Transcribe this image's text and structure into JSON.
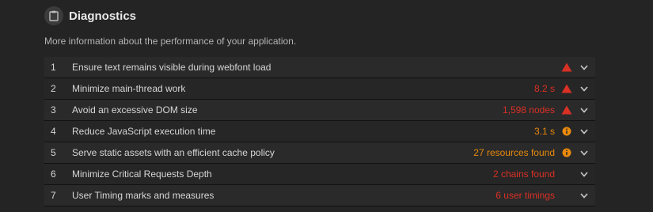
{
  "section": {
    "title": "Diagnostics",
    "description": "More information about the performance of your application.",
    "icon": "clipboard-icon"
  },
  "colors": {
    "fail": "#d93025",
    "average": "#e8890c"
  },
  "audits": [
    {
      "index": "1",
      "label": "Ensure text remains visible during webfont load",
      "value": "",
      "status": "fail",
      "status_icon": "warning-triangle-icon"
    },
    {
      "index": "2",
      "label": "Minimize main-thread work",
      "value": "8.2 s",
      "status": "fail",
      "status_icon": "warning-triangle-icon"
    },
    {
      "index": "3",
      "label": "Avoid an excessive DOM size",
      "value": "1,598 nodes",
      "status": "fail",
      "status_icon": "warning-triangle-icon"
    },
    {
      "index": "4",
      "label": "Reduce JavaScript execution time",
      "value": "3.1 s",
      "status": "average",
      "status_icon": "info-circle-icon"
    },
    {
      "index": "5",
      "label": "Serve static assets with an efficient cache policy",
      "value": "27 resources found",
      "status": "average",
      "status_icon": "info-circle-icon"
    },
    {
      "index": "6",
      "label": "Minimize Critical Requests Depth",
      "value": "2 chains found",
      "status": "fail",
      "status_icon": ""
    },
    {
      "index": "7",
      "label": "User Timing marks and measures",
      "value": "6 user timings",
      "status": "fail",
      "status_icon": ""
    }
  ]
}
